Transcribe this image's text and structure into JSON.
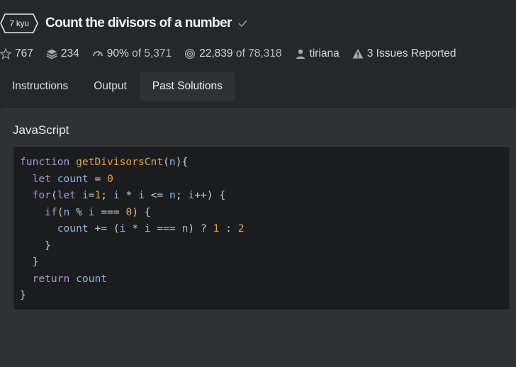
{
  "kata": {
    "rank": "7 kyu",
    "title": "Count the divisors of a number"
  },
  "stats": {
    "stars": "767",
    "collections": "234",
    "satisfaction": "90%",
    "satisfaction_of": "of 5,371",
    "completed": "22,839",
    "completed_of": "of 78,318",
    "author": "tiriana",
    "issues": "3 Issues Reported"
  },
  "tabs": [
    {
      "label": "Instructions",
      "active": false
    },
    {
      "label": "Output",
      "active": false
    },
    {
      "label": "Past Solutions",
      "active": true
    }
  ],
  "solution": {
    "language": "JavaScript",
    "code_lines": [
      "function getDivisorsCnt(n){",
      "  let count = 0",
      "  for(let i=1; i * i <= n; i++) {",
      "    if(n % i === 0) {",
      "      count += (i * i === n) ? 1 : 2",
      "    }",
      "  }",
      "  return count",
      "}"
    ]
  },
  "colors": {
    "background": "#262729",
    "panel": "#303133",
    "code_background": "#1b1c1d",
    "keyword": "#b494d6",
    "function": "#e3a35e",
    "variable": "#8fb6e3",
    "number": "#e3a35e"
  },
  "icons": {
    "rank_badge": "hexagon-badge-icon",
    "title_check": "checkmark-icon",
    "stars": "star-outline-icon",
    "collections": "stack-layers-icon",
    "satisfaction": "gauge-icon",
    "completed": "target-icon",
    "author": "user-icon",
    "issues": "warning-triangle-icon"
  }
}
